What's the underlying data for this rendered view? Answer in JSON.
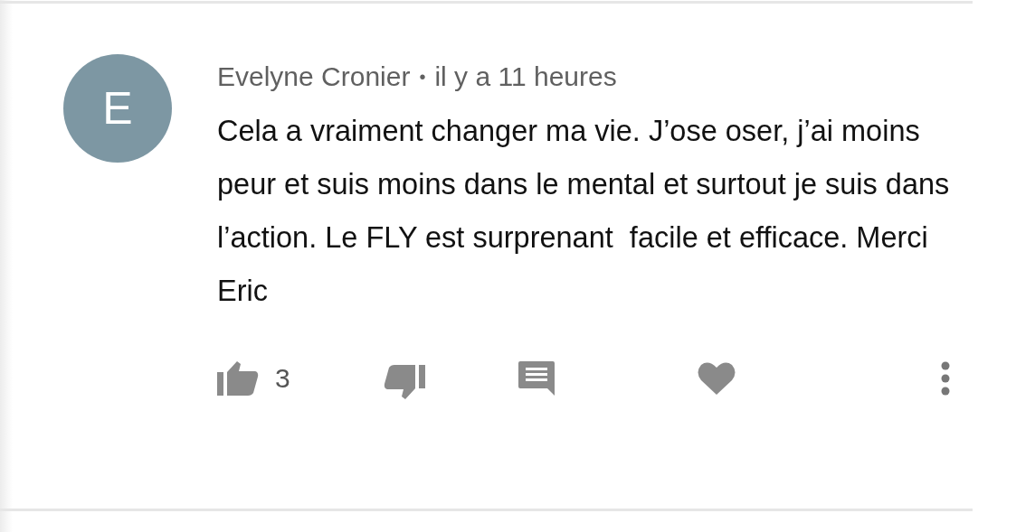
{
  "comment": {
    "avatar_letter": "E",
    "author": "Evelyne Cronier",
    "separator": "•",
    "time": "il y a 11 heures",
    "text": "Cela a vraiment changer ma vie. J’ose oser, j’ai moins peur et suis moins dans le mental et surtout je suis dans l’action. Le FLY est surprenant  facile et efficace. Merci Eric",
    "likes": "3"
  }
}
